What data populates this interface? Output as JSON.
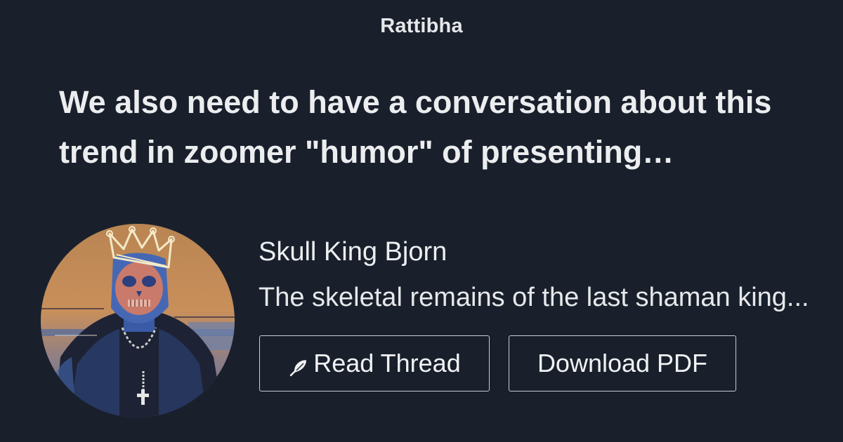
{
  "header": {
    "brand": "Rattibha"
  },
  "thread": {
    "title": "We also need to have a conversation about this trend in zoomer \"humor\" of presenting…"
  },
  "author": {
    "name": "Skull King Bjorn",
    "bio": "The skeletal remains of the last shaman king..."
  },
  "actions": {
    "read_label": "Read Thread",
    "read_icon": "feather-icon",
    "pdf_label": "Download PDF"
  },
  "colors": {
    "background": "#19202c",
    "text": "#ecedef",
    "button_border": "#c9ccd1"
  }
}
